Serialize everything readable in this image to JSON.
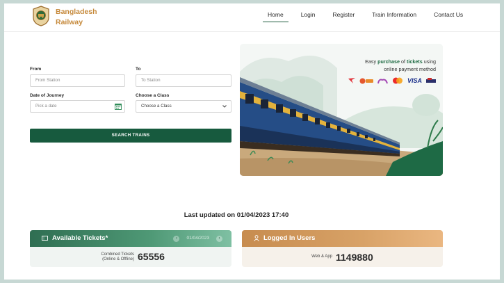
{
  "header": {
    "brand_line1": "Bangladesh",
    "brand_line2": "Railway",
    "nav": [
      {
        "label": "Home"
      },
      {
        "label": "Login"
      },
      {
        "label": "Register"
      },
      {
        "label": "Train Information"
      },
      {
        "label": "Contact Us"
      }
    ]
  },
  "search_form": {
    "from_label": "From",
    "from_placeholder": "From Station",
    "to_label": "To",
    "to_placeholder": "To Station",
    "date_label": "Date of Journey",
    "date_placeholder": "Pick a date",
    "class_label": "Choose a Class",
    "class_value": "Choose a Class",
    "search_button": "SEARCH TRAINS"
  },
  "banner": {
    "text_pre": "Easy ",
    "text_purchase": "purchase",
    "text_mid": " of ",
    "text_tickets": "tickets",
    "text_post": " using",
    "text_line2": "online payment method",
    "payment_methods": [
      "airtel-pay",
      "bkash",
      "nagad",
      "mastercard",
      "VISA",
      "other"
    ]
  },
  "last_updated": "Last updated on 01/04/2023 17:40",
  "stats": {
    "tickets": {
      "title": "Available Tickets*",
      "date": "01/04/2023",
      "sub_label_line1": "Combined Tickets",
      "sub_label_line2": "(Online & Offline)",
      "value": "65556"
    },
    "users": {
      "title": "Logged In Users",
      "sub_label": "Web & App",
      "value": "1149880"
    }
  },
  "colors": {
    "primary_green": "#175a3e",
    "brand_gold": "#c68a3c",
    "users_card": "#d8a267"
  }
}
